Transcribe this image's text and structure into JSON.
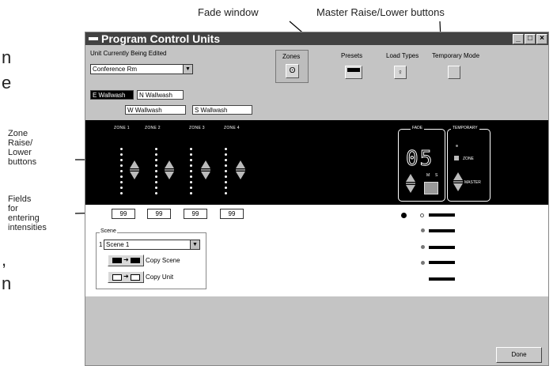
{
  "callouts": {
    "fade_window": "Fade window",
    "master_buttons": "Master Raise/Lower buttons",
    "zone_buttons": [
      "Zone",
      "Raise/",
      "Lower",
      "buttons"
    ],
    "fields": [
      "Fields",
      "for",
      "entering",
      "intensities"
    ]
  },
  "cut_text": [
    "n",
    "e",
    ",",
    "n"
  ],
  "window": {
    "title": "Program Control Units",
    "unit_label": "Unit Currently Being Edited",
    "unit_value": "Conference Rm",
    "toolbar": {
      "zones": "Zones",
      "presets": "Presets",
      "load_types": "Load Types",
      "temporary_mode": "Temporary Mode"
    },
    "zone_fields": [
      "E Wallwash",
      "N Wallwash",
      "W Wallwash",
      "S Wallwash"
    ],
    "zone_headers": [
      "ZONE 1",
      "ZONE 2",
      "ZONE 3",
      "ZONE 4"
    ],
    "fade": {
      "label": "FADE",
      "value": "05",
      "m": "M",
      "s": "S"
    },
    "temporary": {
      "label": "TEMPORARY",
      "zone": "ZONE",
      "master": "MASTER"
    },
    "intensities": [
      "99",
      "99",
      "99",
      "99"
    ],
    "scene": {
      "group_label": "Scene",
      "number": "1",
      "value": "Scene 1",
      "copy_scene": "Copy Scene",
      "copy_unit": "Copy Unit"
    },
    "done": "Done"
  }
}
